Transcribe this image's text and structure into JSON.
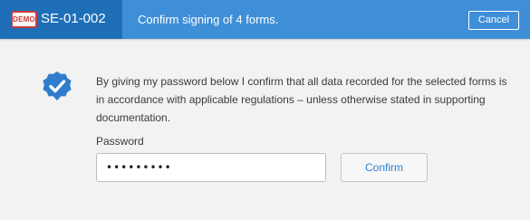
{
  "header": {
    "badge": "DEMO",
    "site_id": "SE-01-002",
    "title": "Confirm signing of 4 forms.",
    "cancel_label": "Cancel"
  },
  "confirmation": {
    "icon": "verified-check-badge-icon",
    "message": "By giving my password below I confirm that all data recorded for the selected forms is in accordance with applicable regulations – unless otherwise stated in supporting documentation."
  },
  "password": {
    "label": "Password",
    "value": "*********"
  },
  "confirm_label": "Confirm",
  "colors": {
    "header": "#3f8fd8",
    "header_dark": "#1e6fb8",
    "badge_red": "#cc3a3a",
    "icon_blue": "#2f7dcb",
    "confirm_text": "#2d7fd0",
    "background": "#f2f2f2"
  }
}
